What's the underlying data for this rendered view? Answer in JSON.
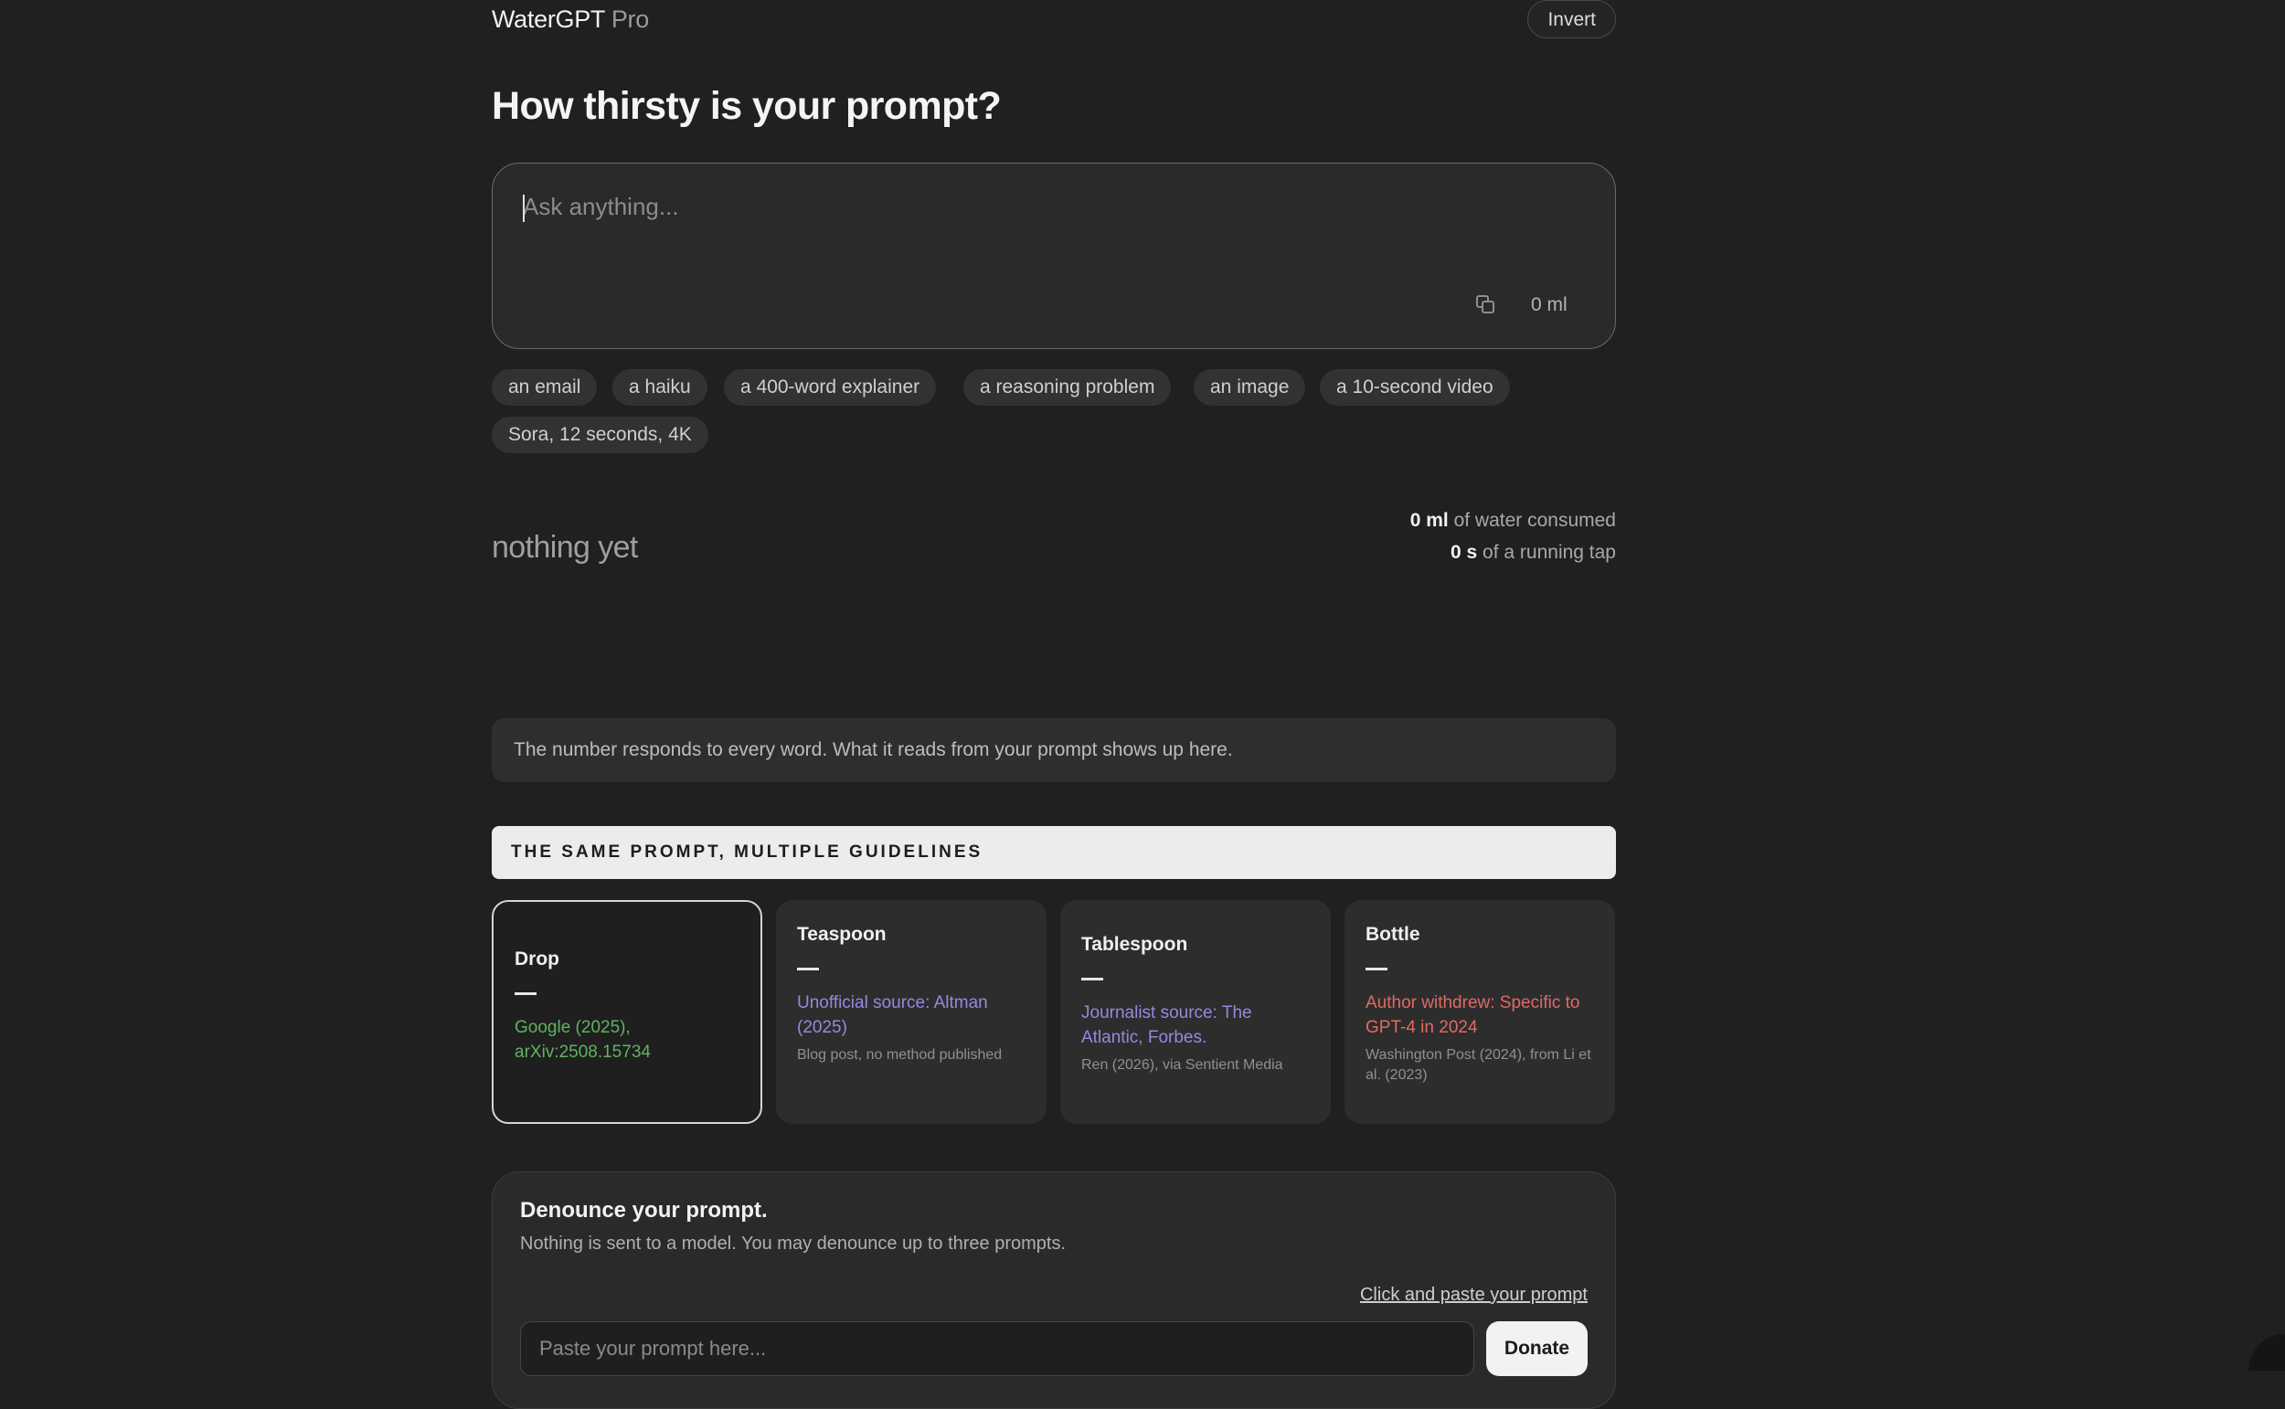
{
  "header": {
    "brand_name": "WaterGPT",
    "brand_suffix": "Pro",
    "invert_label": "Invert"
  },
  "title": "How thirsty is your prompt?",
  "prompt": {
    "placeholder": "Ask anything...",
    "ml_value": "0 ml",
    "copy_icon": "copy-icon"
  },
  "chips": [
    "an email",
    "a haiku",
    "a 400-word explainer",
    "a reasoning problem",
    "an image",
    "a 10-second video",
    "Sora, 12 seconds, 4K"
  ],
  "result": {
    "empty_text": "nothing yet"
  },
  "stats": {
    "water_value": "0 ml",
    "water_label": "of water consumed",
    "tap_value": "0 s",
    "tap_label": "of a running tap"
  },
  "hint": "The number responds to every word. What it reads from your prompt shows up here.",
  "guidelines_heading": "THE SAME PROMPT, MULTIPLE GUIDELINES",
  "guidelines": [
    {
      "name": "Drop",
      "dash": "—",
      "source": "Google (2025), arXiv:2508.15734",
      "note": "",
      "color": "#5fb35f",
      "active": true
    },
    {
      "name": "Teaspoon",
      "dash": "—",
      "source": "Unofficial source: Altman (2025)",
      "note": "Blog post, no method published",
      "color": "#9b86e0",
      "active": false
    },
    {
      "name": "Tablespoon",
      "dash": "—",
      "source": "Journalist source: The Atlantic, Forbes.",
      "note": "Ren (2026), via Sentient Media",
      "color": "#9b86e0",
      "active": false
    },
    {
      "name": "Bottle",
      "dash": "—",
      "source": "Author withdrew: Specific to GPT-4 in 2024",
      "note": "Washington Post (2024), from Li et al. (2023)",
      "color": "#e06a64",
      "active": false
    }
  ],
  "denounce": {
    "title": "Denounce your prompt.",
    "subtitle": "Nothing is sent to a model. You may denounce up to three prompts.",
    "paste_link": "Click and paste your prompt",
    "input_placeholder": "Paste your prompt here...",
    "donate_label": "Donate"
  }
}
